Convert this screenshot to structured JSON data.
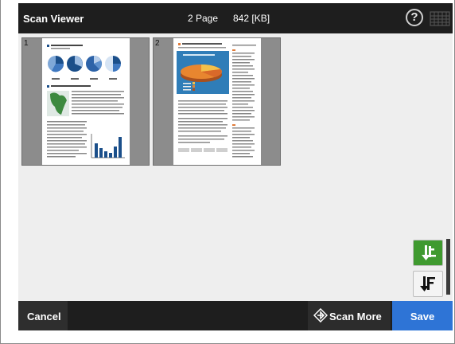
{
  "app": {
    "title": "Scan Viewer",
    "page_count": "2 Page",
    "file_size": "842 [KB]"
  },
  "header": {
    "help_label": "?"
  },
  "thumbnails": [
    {
      "number": "1"
    },
    {
      "number": "2"
    }
  ],
  "side_buttons": [
    {
      "icon": "sort-order-active-icon",
      "accent": "#3f9a2f"
    },
    {
      "icon": "sort-order-icon",
      "accent": "#111111"
    }
  ],
  "footer": {
    "cancel_label": "Cancel",
    "scan_more_label": "Scan More",
    "save_label": "Save"
  },
  "colors": {
    "titlebar": "#1e1e1e",
    "save": "#2e74d6",
    "background": "#eeeeee"
  }
}
